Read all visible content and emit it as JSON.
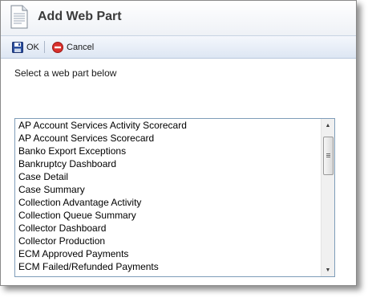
{
  "dialog": {
    "title": "Add Web Part",
    "icon": "document-icon"
  },
  "toolbar": {
    "ok_label": "OK",
    "cancel_label": "Cancel",
    "ok_icon": "save-icon",
    "cancel_icon": "cancel-icon"
  },
  "main": {
    "instruction": "Select a web part below",
    "web_parts": [
      "AP Account Services Activity Scorecard",
      "AP Account Services Scorecard",
      "Banko Export Exceptions",
      "Bankruptcy Dashboard",
      "Case Detail",
      "Case Summary",
      "Collection Advantage Activity",
      "Collection Queue Summary",
      "Collector Dashboard",
      "Collector Production",
      "ECM Approved Payments",
      "ECM Failed/Refunded Payments"
    ]
  },
  "colors": {
    "toolbar_gradient_top": "#f4f7fc",
    "toolbar_gradient_bottom": "#dde6f3",
    "listbox_border": "#7f9db9",
    "cancel_red": "#d9302c",
    "save_blue": "#2b4f9e"
  }
}
